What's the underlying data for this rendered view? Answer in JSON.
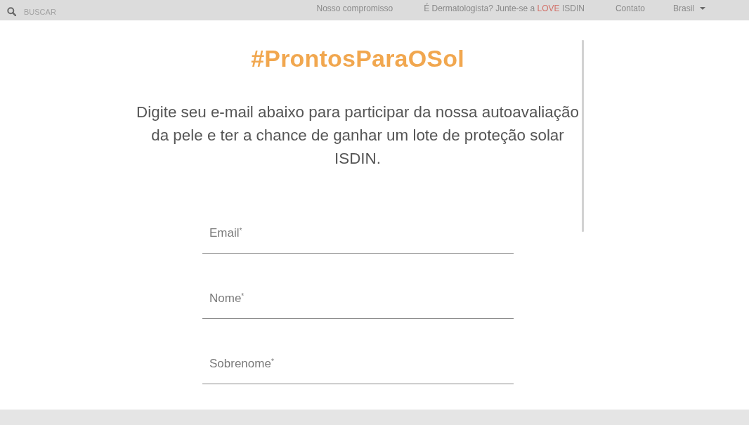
{
  "top_bar": {
    "search": {
      "placeholder": "BUSCAR"
    },
    "nav_links": [
      {
        "parts": [
          {
            "text": "Nosso compromisso",
            "accent": false
          }
        ]
      },
      {
        "parts": [
          {
            "text": "É Dermatologista? Junte-se a ",
            "accent": false
          },
          {
            "text": "LOVE",
            "accent": true
          },
          {
            "text": " ISDIN",
            "accent": false
          }
        ]
      },
      {
        "parts": [
          {
            "text": "Contato",
            "accent": false
          }
        ]
      }
    ],
    "country_selector": {
      "value": "Brasil"
    }
  },
  "hero": {
    "title": "#ProntosParaOSol",
    "intro": "Digite seu e-mail abaixo para participar da nossa autoavaliação da pele e ter a chance de ganhar um lote de proteção solar ISDIN."
  },
  "form": {
    "fields": [
      {
        "label": "Email$^{*}$"
      },
      {
        "label": "Nome$^{*}$"
      },
      {
        "label": "Sobrenome$^{*}$"
      }
    ]
  }
}
